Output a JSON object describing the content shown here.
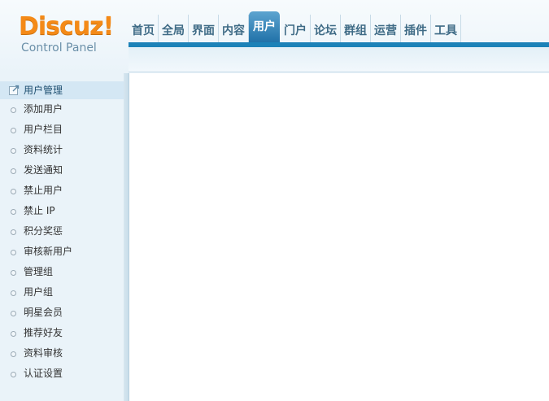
{
  "logo": {
    "word": "Discuz!",
    "subtitle": "Control Panel"
  },
  "nav": {
    "items": [
      {
        "label": "首页",
        "active": false
      },
      {
        "label": "全局",
        "active": false
      },
      {
        "label": "界面",
        "active": false
      },
      {
        "label": "内容",
        "active": false
      },
      {
        "label": "用户",
        "active": true
      },
      {
        "label": "门户",
        "active": false
      },
      {
        "label": "论坛",
        "active": false
      },
      {
        "label": "群组",
        "active": false
      },
      {
        "label": "运营",
        "active": false
      },
      {
        "label": "插件",
        "active": false
      },
      {
        "label": "工具",
        "active": false
      }
    ]
  },
  "sidebar": {
    "title": "用户管理",
    "title_icon": "external-link-icon",
    "bullet_icon": "circle-bullet-icon",
    "items": [
      "添加用户",
      "用户栏目",
      "资料统计",
      "发送通知",
      "禁止用户",
      "禁止 IP",
      "积分奖惩",
      "审核新用户",
      "管理组",
      "用户组",
      "明星会员",
      "推荐好友",
      "资料审核",
      "认证设置"
    ]
  },
  "colors": {
    "brand_orange": "#f48a17",
    "accent_blue": "#1c82b8",
    "active_tab": "#2a7db4",
    "sidebar_bg": "#eaf3f9"
  }
}
